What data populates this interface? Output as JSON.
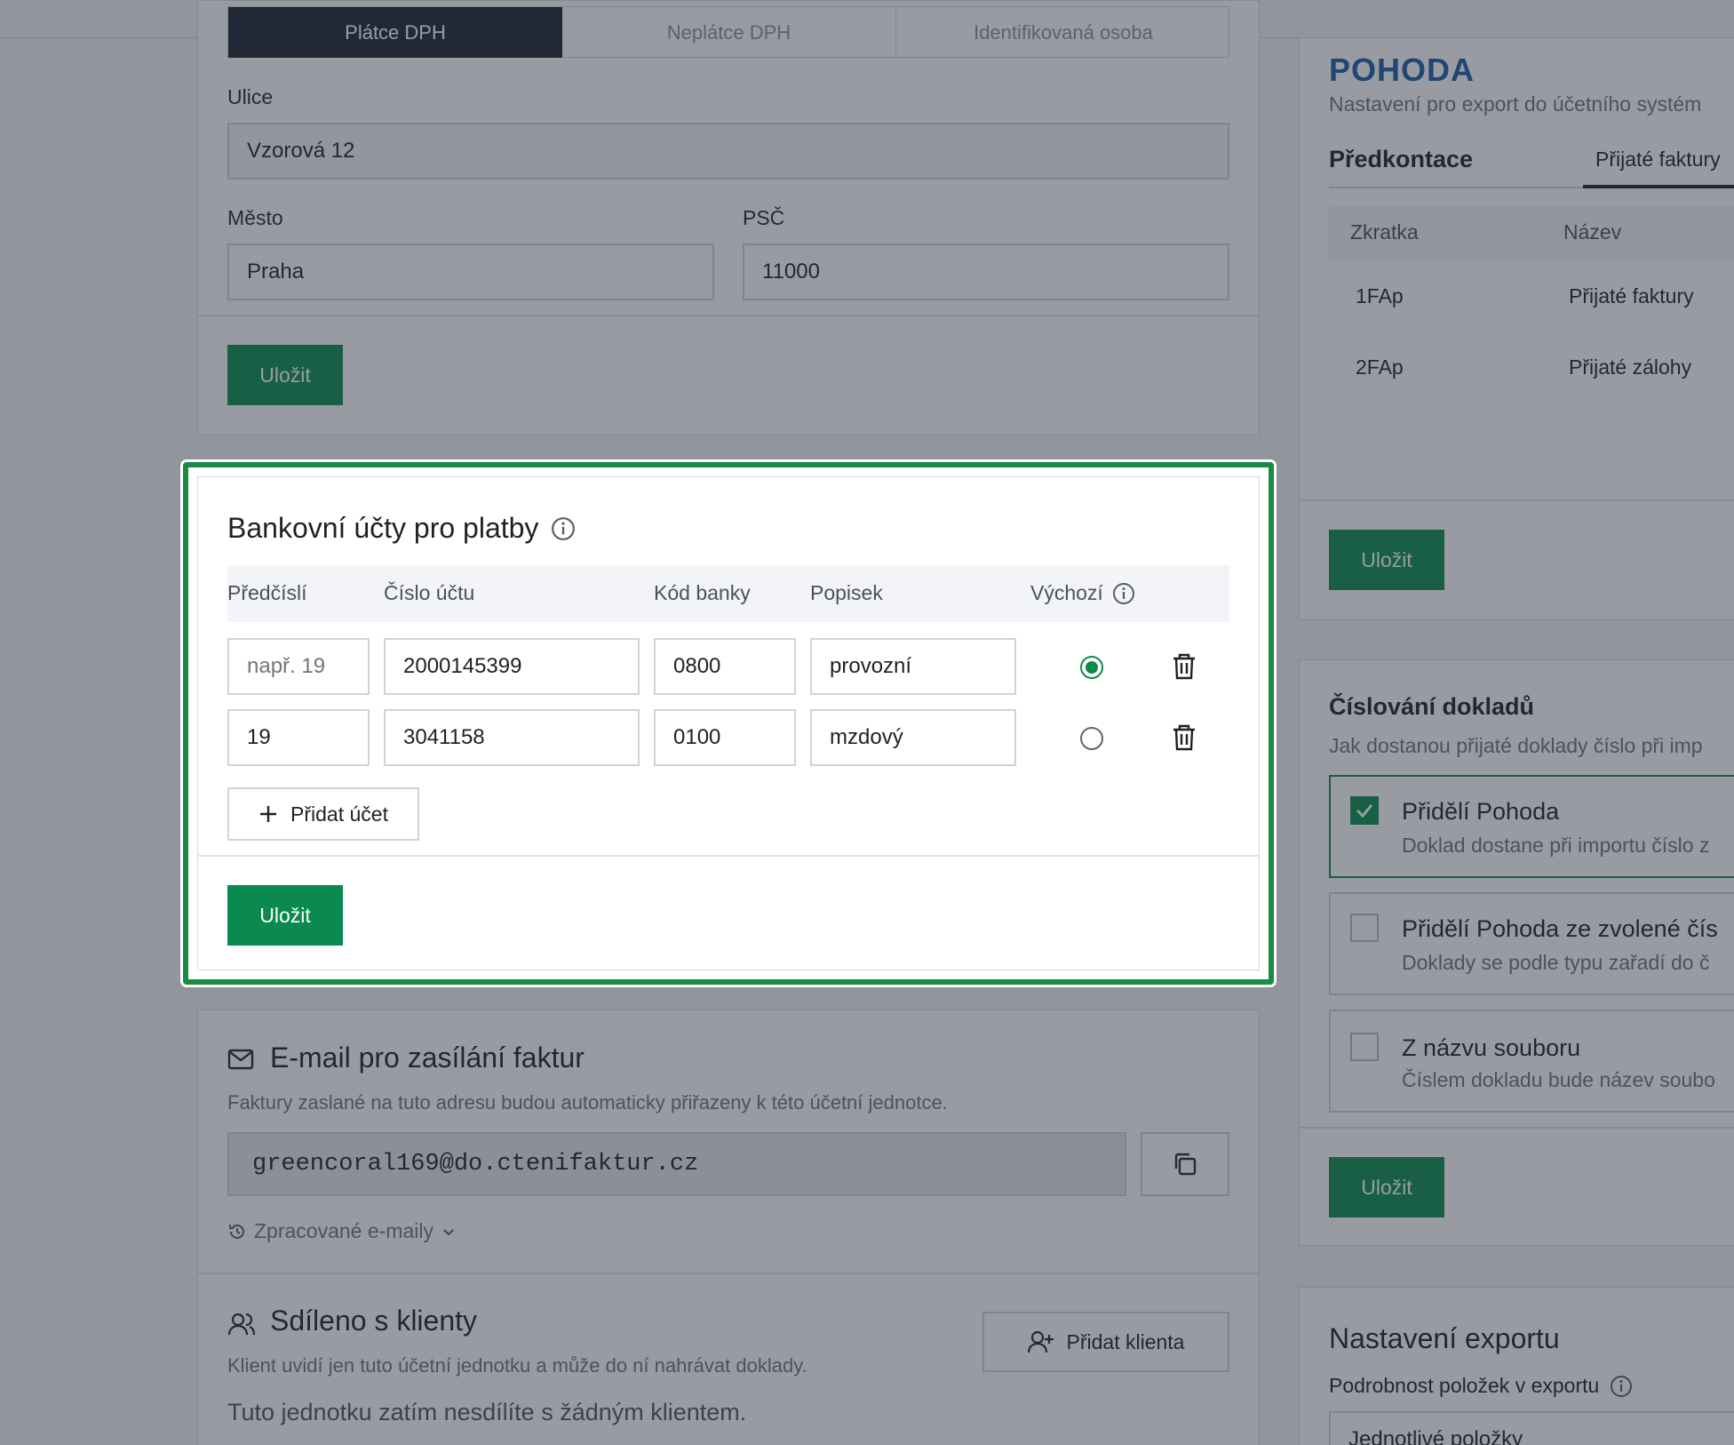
{
  "vat_tabs": [
    "Plátce DPH",
    "Neplátce DPH",
    "Identifikovaná osoba"
  ],
  "address": {
    "street_label": "Ulice",
    "street_value": "Vzorová 12",
    "city_label": "Město",
    "city_value": "Praha",
    "zip_label": "PSČ",
    "zip_value": "11000",
    "save_label": "Uložit"
  },
  "bank": {
    "title": "Bankovní účty pro platby",
    "columns": [
      "Předčíslí",
      "Číslo účtu",
      "Kód banky",
      "Popisek",
      "Výchozí"
    ],
    "rows": [
      {
        "prefix": "",
        "prefix_placeholder": "např. 19",
        "number": "2000145399",
        "bank_code": "0800",
        "label": "provozní",
        "default": true
      },
      {
        "prefix": "19",
        "prefix_placeholder": "",
        "number": "3041158",
        "bank_code": "0100",
        "label": "mzdový",
        "default": false
      }
    ],
    "add_label": "Přidat účet",
    "save_label": "Uložit"
  },
  "email": {
    "title": "E-mail pro zasílání faktur",
    "description": "Faktury zaslané na tuto adresu budou automaticky přiřazeny k této účetní jednotce.",
    "address": "greencoral169@do.ctenifaktur.cz",
    "processed_label": "Zpracované e-maily"
  },
  "shared": {
    "title": "Sdíleno s klienty",
    "description": "Klient uvidí jen tuto účetní jednotku a může do ní nahrávat doklady.",
    "add_client_label": "Přidat klienta",
    "empty_text": "Tuto jednotku zatím nesdílíte s žádným klientem."
  },
  "pohoda": {
    "logo": "POHODA",
    "subtitle": "Nastavení pro export do účetního systém",
    "tabs": [
      "Předkontace",
      "Přijaté faktury"
    ],
    "columns": [
      "Zkratka",
      "Název"
    ],
    "rows": [
      {
        "code": "1FAp",
        "name": "Přijaté faktury"
      },
      {
        "code": "2FAp",
        "name": "Přijaté zálohy"
      }
    ],
    "save_label": "Uložit"
  },
  "numbering": {
    "title": "Číslování dokladů",
    "subtitle": "Jak dostanou přijaté doklady číslo při imp",
    "options": [
      {
        "title": "Přidělí Pohoda",
        "desc": "Doklad dostane při importu číslo z",
        "checked": true
      },
      {
        "title": "Přidělí Pohoda ze zvolené čís",
        "desc": "Doklady se podle typu zařadí do č",
        "checked": false
      },
      {
        "title": "Z názvu souboru",
        "desc": "Číslem dokladu bude název soubo",
        "checked": false
      }
    ],
    "save_label": "Uložit"
  },
  "export": {
    "title": "Nastavení exportu",
    "detail_label": "Podrobnost položek v exportu",
    "detail_value": "Jednotlivé položky"
  },
  "colors": {
    "accent": "#0b8a4f",
    "focus_border": "#1a8a45"
  }
}
